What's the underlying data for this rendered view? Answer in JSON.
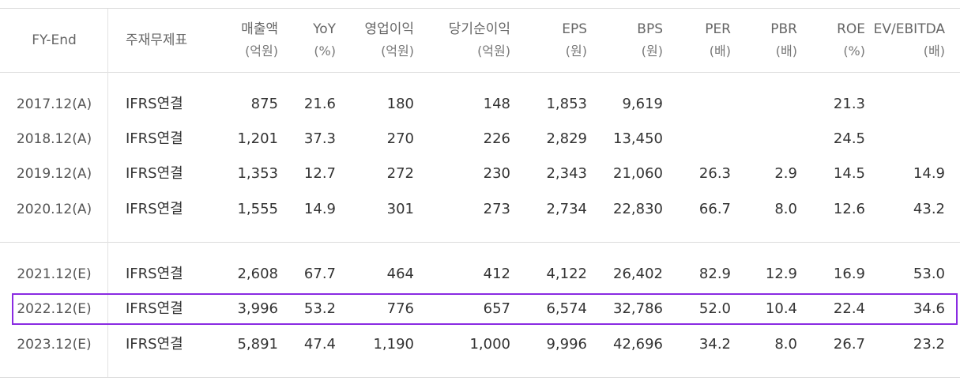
{
  "headers": [
    {
      "key": "fy",
      "l1": "FY-End",
      "l2": ""
    },
    {
      "key": "stmt",
      "l1": "주재무제표",
      "l2": ""
    },
    {
      "key": "sales",
      "l1": "매출액",
      "l2": "(억원)"
    },
    {
      "key": "yoy",
      "l1": "YoY",
      "l2": "(%)"
    },
    {
      "key": "op",
      "l1": "영업이익",
      "l2": "(억원)"
    },
    {
      "key": "net",
      "l1": "당기순이익",
      "l2": "(억원)"
    },
    {
      "key": "eps",
      "l1": "EPS",
      "l2": "(원)"
    },
    {
      "key": "bps",
      "l1": "BPS",
      "l2": "(원)"
    },
    {
      "key": "per",
      "l1": "PER",
      "l2": "(배)"
    },
    {
      "key": "pbr",
      "l1": "PBR",
      "l2": "(배)"
    },
    {
      "key": "roe",
      "l1": "ROE",
      "l2": "(%)"
    },
    {
      "key": "ev",
      "l1": "EV/EBITDA",
      "l2": "(배)"
    }
  ],
  "rows": [
    {
      "year": "2017.12(A)",
      "stmt": "IFRS연결",
      "sales": "875",
      "yoy": "21.6",
      "op": "180",
      "net": "148",
      "eps": "1,853",
      "bps": "9,619",
      "per": "",
      "pbr": "",
      "roe": "21.3",
      "ev": ""
    },
    {
      "year": "2018.12(A)",
      "stmt": "IFRS연결",
      "sales": "1,201",
      "yoy": "37.3",
      "op": "270",
      "net": "226",
      "eps": "2,829",
      "bps": "13,450",
      "per": "",
      "pbr": "",
      "roe": "24.5",
      "ev": ""
    },
    {
      "year": "2019.12(A)",
      "stmt": "IFRS연결",
      "sales": "1,353",
      "yoy": "12.7",
      "op": "272",
      "net": "230",
      "eps": "2,343",
      "bps": "21,060",
      "per": "26.3",
      "pbr": "2.9",
      "roe": "14.5",
      "ev": "14.9"
    },
    {
      "year": "2020.12(A)",
      "stmt": "IFRS연결",
      "sales": "1,555",
      "yoy": "14.9",
      "op": "301",
      "net": "273",
      "eps": "2,734",
      "bps": "22,830",
      "per": "66.7",
      "pbr": "8.0",
      "roe": "12.6",
      "ev": "43.2"
    },
    {
      "year": "2021.12(E)",
      "stmt": "IFRS연결",
      "sales": "2,608",
      "yoy": "67.7",
      "op": "464",
      "net": "412",
      "eps": "4,122",
      "bps": "26,402",
      "per": "82.9",
      "pbr": "12.9",
      "roe": "16.9",
      "ev": "53.0"
    },
    {
      "year": "2022.12(E)",
      "stmt": "IFRS연결",
      "sales": "3,996",
      "yoy": "53.2",
      "op": "776",
      "net": "657",
      "eps": "6,574",
      "bps": "32,786",
      "per": "52.0",
      "pbr": "10.4",
      "roe": "22.4",
      "ev": "34.6"
    },
    {
      "year": "2023.12(E)",
      "stmt": "IFRS연결",
      "sales": "5,891",
      "yoy": "47.4",
      "op": "1,190",
      "net": "1,000",
      "eps": "9,996",
      "bps": "42,696",
      "per": "34.2",
      "pbr": "8.0",
      "roe": "26.7",
      "ev": "23.2"
    }
  ],
  "highlight_color": "#8a2be2"
}
